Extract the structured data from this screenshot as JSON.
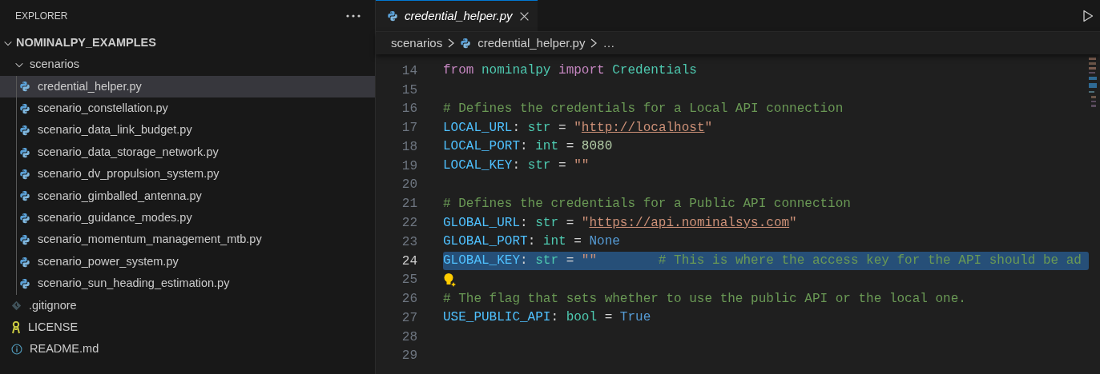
{
  "sidebar": {
    "title": "EXPLORER",
    "tree": [
      {
        "label": "NOMINALPY_EXAMPLES",
        "kind": "root",
        "expanded": true,
        "selected": false,
        "children": [
          {
            "label": "scenarios",
            "kind": "folder",
            "expanded": true,
            "selected": false,
            "children": [
              {
                "label": "credential_helper.py",
                "kind": "python",
                "selected": true
              },
              {
                "label": "scenario_constellation.py",
                "kind": "python",
                "selected": false
              },
              {
                "label": "scenario_data_link_budget.py",
                "kind": "python",
                "selected": false
              },
              {
                "label": "scenario_data_storage_network.py",
                "kind": "python",
                "selected": false
              },
              {
                "label": "scenario_dv_propulsion_system.py",
                "kind": "python",
                "selected": false
              },
              {
                "label": "scenario_gimballed_antenna.py",
                "kind": "python",
                "selected": false
              },
              {
                "label": "scenario_guidance_modes.py",
                "kind": "python",
                "selected": false
              },
              {
                "label": "scenario_momentum_management_mtb.py",
                "kind": "python",
                "selected": false
              },
              {
                "label": "scenario_power_system.py",
                "kind": "python",
                "selected": false
              },
              {
                "label": "scenario_sun_heading_estimation.py",
                "kind": "python",
                "selected": false
              }
            ]
          },
          {
            "label": ".gitignore",
            "kind": "git",
            "selected": false
          },
          {
            "label": "LICENSE",
            "kind": "license",
            "selected": false
          },
          {
            "label": "README.md",
            "kind": "info",
            "selected": false
          }
        ]
      }
    ]
  },
  "tabs": [
    {
      "label": "credential_helper.py",
      "selected": true
    }
  ],
  "breadcrumb": [
    {
      "label": "scenarios",
      "kind": "folder"
    },
    {
      "label": "credential_helper.py",
      "kind": "python"
    },
    {
      "label": "…",
      "kind": "more"
    }
  ],
  "editor": {
    "lines": [
      {
        "number": "14",
        "selected": false,
        "lightbulb": false,
        "tokens": [
          {
            "kind": "keyword",
            "text": "from"
          },
          {
            "kind": "module",
            "text": " nominalpy"
          },
          {
            "kind": "keyword",
            "text": " import"
          },
          {
            "kind": "class",
            "text": " Credentials"
          }
        ]
      },
      {
        "number": "15",
        "selected": false,
        "lightbulb": false
      },
      {
        "number": "16",
        "selected": false,
        "lightbulb": false,
        "tokens": [
          {
            "kind": "comment",
            "text": "# Defines the credentials for a Local API connection"
          }
        ]
      },
      {
        "number": "17",
        "selected": false,
        "lightbulb": false,
        "tokens": [
          {
            "kind": "variable",
            "text": "LOCAL_URL"
          },
          {
            "kind": "plain",
            "text": ": "
          },
          {
            "kind": "class",
            "text": "str"
          },
          {
            "kind": "plain",
            "text": " = "
          },
          {
            "kind": "string",
            "text": "\""
          },
          {
            "kind": "link",
            "text": "http://localhost"
          },
          {
            "kind": "string",
            "text": "\""
          }
        ]
      },
      {
        "number": "18",
        "selected": false,
        "lightbulb": false,
        "tokens": [
          {
            "kind": "variable",
            "text": "LOCAL_PORT"
          },
          {
            "kind": "plain",
            "text": ": "
          },
          {
            "kind": "class",
            "text": "int"
          },
          {
            "kind": "plain",
            "text": " = "
          },
          {
            "kind": "number",
            "text": "8080"
          }
        ]
      },
      {
        "number": "19",
        "selected": false,
        "lightbulb": false,
        "tokens": [
          {
            "kind": "variable",
            "text": "LOCAL_KEY"
          },
          {
            "kind": "plain",
            "text": ": "
          },
          {
            "kind": "class",
            "text": "str"
          },
          {
            "kind": "plain",
            "text": " = "
          },
          {
            "kind": "string",
            "text": "\"\""
          }
        ]
      },
      {
        "number": "20",
        "selected": false,
        "lightbulb": false
      },
      {
        "number": "21",
        "selected": false,
        "lightbulb": false,
        "tokens": [
          {
            "kind": "comment",
            "text": "# Defines the credentials for a Public API connection"
          }
        ]
      },
      {
        "number": "22",
        "selected": false,
        "lightbulb": false,
        "tokens": [
          {
            "kind": "variable",
            "text": "GLOBAL_URL"
          },
          {
            "kind": "plain",
            "text": ": "
          },
          {
            "kind": "class",
            "text": "str"
          },
          {
            "kind": "plain",
            "text": " = "
          },
          {
            "kind": "string",
            "text": "\""
          },
          {
            "kind": "link",
            "text": "https://api.nominalsys.com"
          },
          {
            "kind": "string",
            "text": "\""
          }
        ]
      },
      {
        "number": "23",
        "selected": false,
        "lightbulb": false,
        "tokens": [
          {
            "kind": "variable",
            "text": "GLOBAL_PORT"
          },
          {
            "kind": "plain",
            "text": ": "
          },
          {
            "kind": "class",
            "text": "int"
          },
          {
            "kind": "plain",
            "text": " = "
          },
          {
            "kind": "constant",
            "text": "None"
          }
        ]
      },
      {
        "number": "24",
        "selected": true,
        "lightbulb": false,
        "tokens": [
          {
            "kind": "variable",
            "text": "GLOBAL_KEY"
          },
          {
            "kind": "plain",
            "text": ": "
          },
          {
            "kind": "class",
            "text": "str"
          },
          {
            "kind": "plain",
            "text": " = "
          },
          {
            "kind": "string",
            "text": "\"\""
          },
          {
            "kind": "comment",
            "text": "        # This is where the access key for the API should be ad"
          }
        ]
      },
      {
        "number": "25",
        "selected": false,
        "lightbulb": true
      },
      {
        "number": "26",
        "selected": false,
        "lightbulb": false,
        "tokens": [
          {
            "kind": "comment",
            "text": "# The flag that sets whether to use the public API or the local one."
          }
        ]
      },
      {
        "number": "27",
        "selected": false,
        "lightbulb": false,
        "tokens": [
          {
            "kind": "variable",
            "text": "USE_PUBLIC_API"
          },
          {
            "kind": "plain",
            "text": ": "
          },
          {
            "kind": "class",
            "text": "bool"
          },
          {
            "kind": "plain",
            "text": " = "
          },
          {
            "kind": "constant",
            "text": "True"
          }
        ]
      },
      {
        "number": "28",
        "selected": false,
        "lightbulb": false
      },
      {
        "number": "29",
        "selected": false,
        "lightbulb": false
      }
    ]
  }
}
